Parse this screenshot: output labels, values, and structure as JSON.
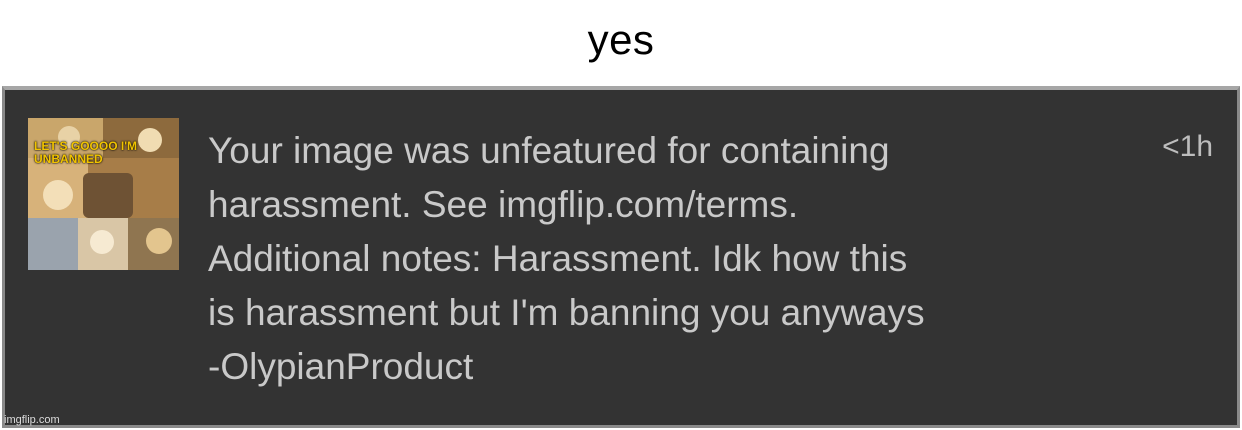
{
  "caption": "yes",
  "notification": {
    "thumbnail_text": "LET'S GOOOO I'M UNBANNED",
    "message_lines": [
      "Your image was unfeatured for containing",
      "harassment. See imgflip.com/terms.",
      "Additional notes: Harassment. Idk how this",
      "is harassment but I'm banning you anyways",
      "-OlypianProduct"
    ],
    "time": "<1h"
  },
  "watermark": "imgflip.com"
}
